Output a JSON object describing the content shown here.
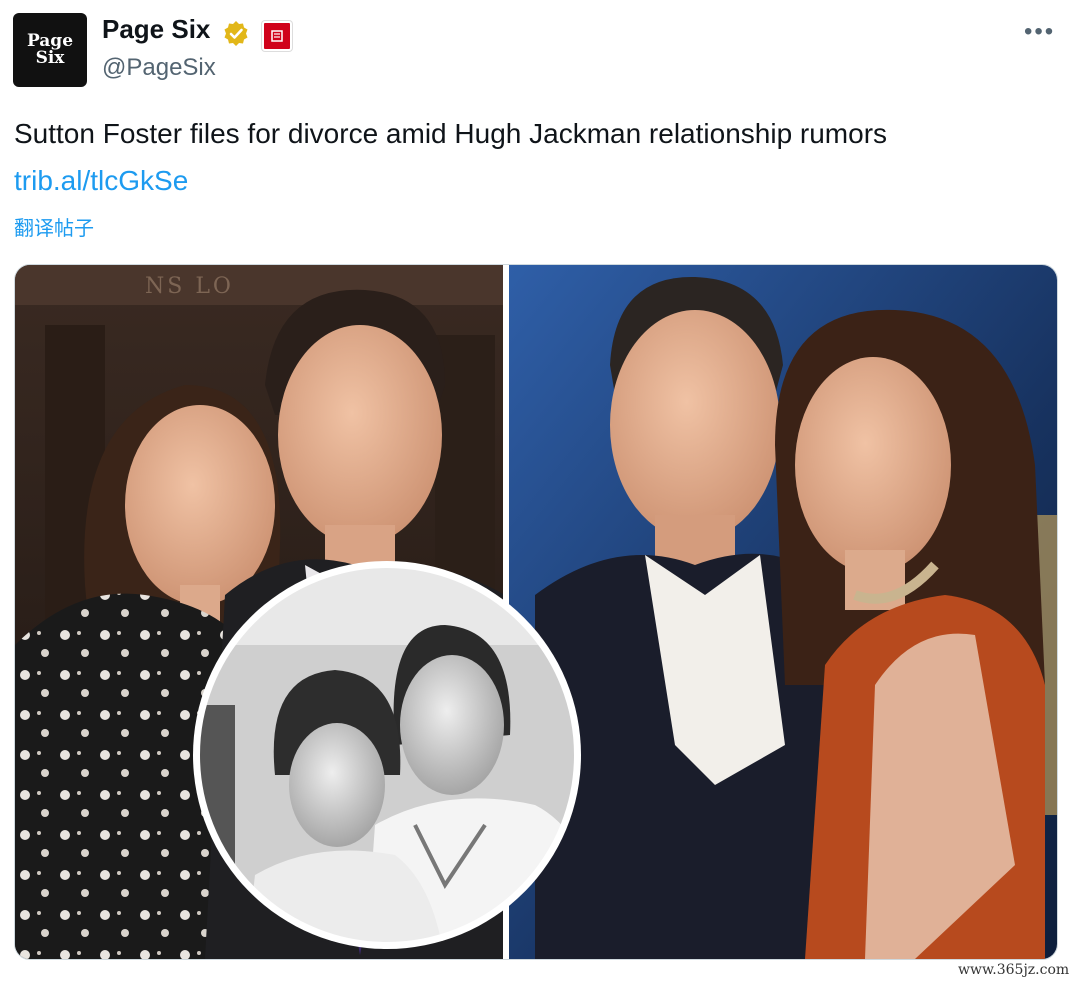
{
  "account": {
    "avatar_line1": "Page",
    "avatar_line2": "Six",
    "display_name": "Page Six",
    "handle": "@PageSix"
  },
  "tweet": {
    "text": "Sutton Foster files for divorce amid Hugh Jackman relationship rumors",
    "link": "trib.al/tlcGkSe",
    "translate": "翻译帖子"
  },
  "media": {
    "background_sign": "NS LO"
  },
  "watermark": "www.365jz.com",
  "colors": {
    "link": "#1d9bf0",
    "verified": "#e2b719",
    "org_badge": "#d0021b"
  },
  "icons": {
    "verified": "verified-badge-icon",
    "org": "org-badge-icon",
    "more": "more-options-icon"
  }
}
